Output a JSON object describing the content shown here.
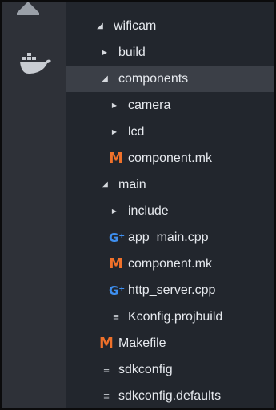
{
  "colors": {
    "sidebar_bg": "#22262d",
    "activity_bar_bg": "#2e3138",
    "selected_row_bg": "#3b3f47",
    "makefile_icon": "#f0712a",
    "cpp_icon": "#3e8ff0"
  },
  "activity_bar": {
    "icons": [
      "explorer-icon",
      "docker-icon"
    ]
  },
  "tree": {
    "items": [
      {
        "label": "wificam",
        "kind": "folder",
        "state": "expanded",
        "level": 1
      },
      {
        "label": "build",
        "kind": "folder",
        "state": "collapsed",
        "level": 2
      },
      {
        "label": "components",
        "kind": "folder",
        "state": "expanded",
        "level": 2,
        "selected": true
      },
      {
        "label": "camera",
        "kind": "folder",
        "state": "collapsed",
        "level": 3
      },
      {
        "label": "lcd",
        "kind": "folder",
        "state": "collapsed",
        "level": 3
      },
      {
        "label": "component.mk",
        "kind": "file",
        "icon": "makefile-icon",
        "icon_glyph": "M",
        "level": 3
      },
      {
        "label": "main",
        "kind": "folder",
        "state": "expanded",
        "level": 2
      },
      {
        "label": "include",
        "kind": "folder",
        "state": "collapsed",
        "level": 3
      },
      {
        "label": "app_main.cpp",
        "kind": "file",
        "icon": "cpp-icon",
        "icon_glyph": "G⁺",
        "level": 3
      },
      {
        "label": "component.mk",
        "kind": "file",
        "icon": "makefile-icon",
        "icon_glyph": "M",
        "level": 3
      },
      {
        "label": "http_server.cpp",
        "kind": "file",
        "icon": "cpp-icon",
        "icon_glyph": "G⁺",
        "level": 3
      },
      {
        "label": "Kconfig.projbuild",
        "kind": "file",
        "icon": "text-lines-icon",
        "icon_glyph": "≡",
        "level": 3
      },
      {
        "label": "Makefile",
        "kind": "file",
        "icon": "makefile-icon",
        "icon_glyph": "M",
        "level": 2
      },
      {
        "label": "sdkconfig",
        "kind": "file",
        "icon": "text-lines-icon",
        "icon_glyph": "≡",
        "level": 2
      },
      {
        "label": "sdkconfig.defaults",
        "kind": "file",
        "icon": "text-lines-icon",
        "icon_glyph": "≡",
        "level": 2
      }
    ]
  }
}
